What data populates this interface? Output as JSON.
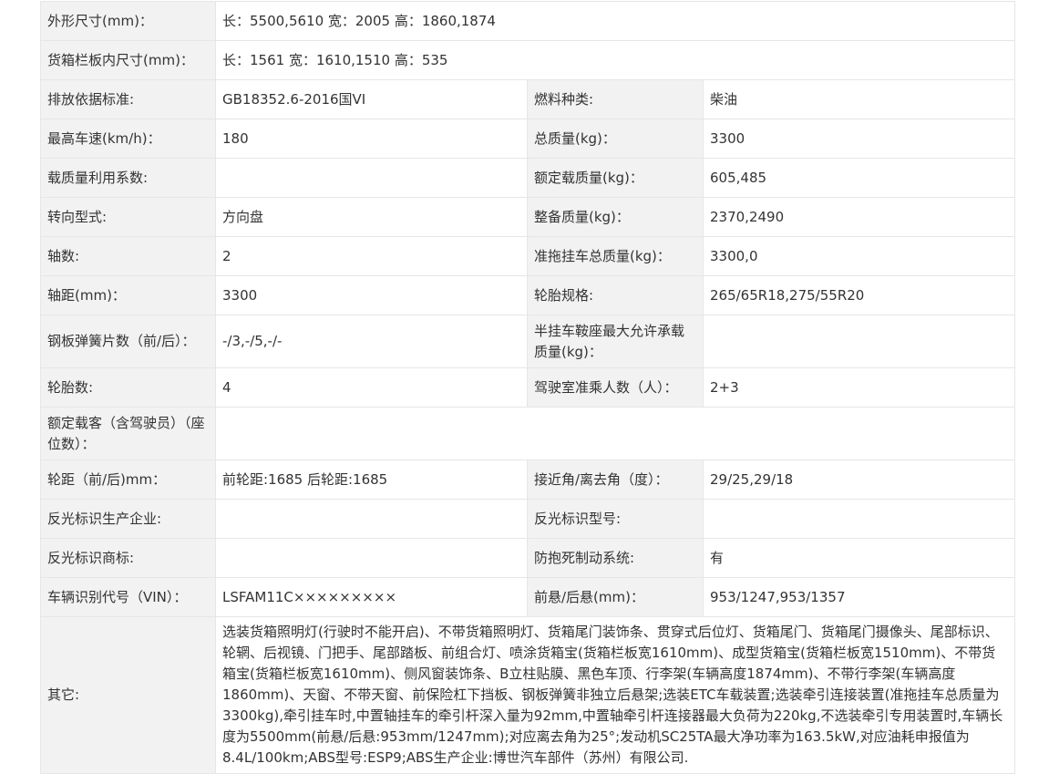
{
  "rows": [
    {
      "type": "wide",
      "label": "外形尺寸(mm)：",
      "value": "长：5500,5610 宽：2005 高：1860,1874"
    },
    {
      "type": "wide",
      "label": "货箱栏板内尺寸(mm)：",
      "value": "长：1561 宽：1610,1510 高：535"
    },
    {
      "type": "pair",
      "label1": "排放依据标准:",
      "value1": "GB18352.6-2016国VI",
      "label2": "燃料种类:",
      "value2": "柴油"
    },
    {
      "type": "pair",
      "label1": "最高车速(km/h)：",
      "value1": "180",
      "label2": "总质量(kg)：",
      "value2": "3300"
    },
    {
      "type": "pair",
      "label1": "载质量利用系数:",
      "value1": "",
      "label2": "额定载质量(kg)：",
      "value2": "605,485"
    },
    {
      "type": "pair",
      "label1": "转向型式:",
      "value1": "方向盘",
      "label2": "整备质量(kg)：",
      "value2": "2370,2490"
    },
    {
      "type": "pair",
      "label1": "轴数:",
      "value1": "2",
      "label2": "准拖挂车总质量(kg)：",
      "value2": "3300,0"
    },
    {
      "type": "pair",
      "label1": "轴距(mm)：",
      "value1": "3300",
      "label2": "轮胎规格:",
      "value2": "265/65R18,275/55R20"
    },
    {
      "type": "pair",
      "label1": "钢板弹簧片数（前/后）：",
      "value1": "-/3,-/5,-/-",
      "label2": "半挂车鞍座最大允许承载质量(kg)：",
      "value2": ""
    },
    {
      "type": "pair",
      "label1": "轮胎数:",
      "value1": "4",
      "label2": "驾驶室准乘人数（人）：",
      "value2": "2+3"
    },
    {
      "type": "wide",
      "label": "额定载客（含驾驶员）（座位数）：",
      "value": ""
    },
    {
      "type": "pair",
      "label1": "轮距（前/后)mm：",
      "value1": "前轮距:1685 后轮距:1685",
      "label2": "接近角/离去角（度）：",
      "value2": "29/25,29/18"
    },
    {
      "type": "pair",
      "label1": "反光标识生产企业:",
      "value1": "",
      "label2": "反光标识型号:",
      "value2": ""
    },
    {
      "type": "pair",
      "label1": "反光标识商标:",
      "value1": "",
      "label2": "防抱死制动系统:",
      "value2": "有"
    },
    {
      "type": "pair",
      "label1": "车辆识别代号（VIN）：",
      "value1": "LSFAM11C×××××××××",
      "label2": "前悬/后悬(mm)：",
      "value2": "953/1247,953/1357"
    },
    {
      "type": "wide",
      "label": "其它:",
      "value": "选装货箱照明灯(行驶时不能开启)、不带货箱照明灯、货箱尾门装饰条、贯穿式后位灯、货箱尾门、货箱尾门摄像头、尾部标识、轮辋、后视镜、门把手、尾部踏板、前组合灯、喷涂货箱宝(货箱栏板宽1610mm)、成型货箱宝(货箱栏板宽1510mm)、不带货箱宝(货箱栏板宽1610mm)、侧风窗装饰条、B立柱贴膜、黑色车顶、行李架(车辆高度1874mm)、不带行李架(车辆高度1860mm)、天窗、不带天窗、前保险杠下挡板、钢板弹簧非独立后悬架;选装ETC车载装置;选装牵引连接装置(准拖挂车总质量为3300kg),牵引挂车时,中置轴挂车的牵引杆深入量为92mm,中置轴牵引杆连接器最大负荷为220kg,不选装牵引专用装置时,车辆长度为5500mm(前悬/后悬:953mm/1247mm);对应离去角为25°;发动机SC25TA最大净功率为163.5kW,对应油耗申报值为8.4L/100km;ABS型号:ESP9;ABS生产企业:博世汽车部件（苏州）有限公司."
    }
  ]
}
